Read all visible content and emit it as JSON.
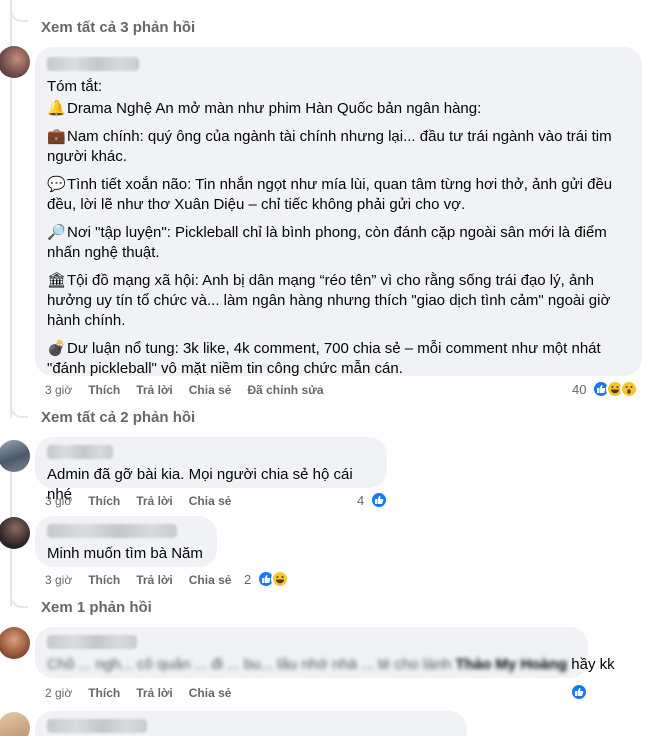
{
  "top_link": "Xem tất cả 3 phản hồi",
  "comment1": {
    "paragraphs": [
      {
        "icon": "",
        "text": "Tóm tắt:"
      },
      {
        "icon": "🔔",
        "icon_name": "bell-icon",
        "text": "Drama Nghệ An mở màn như phim Hàn Quốc bản ngân hàng:"
      },
      {
        "icon": "💼",
        "icon_name": "briefcase-icon",
        "text": "Nam chính: quý ông của ngành tài chính nhưng lại... đầu tư trái ngành vào trái tim người khác."
      },
      {
        "icon": "💬",
        "icon_name": "speech-bubble-icon",
        "text": "Tình tiết xoắn não: Tin nhắn ngọt như mía lùi, quan tâm từng hơi thở, ảnh gửi đều đều, lời lẽ như thơ Xuân Diệu – chỉ tiếc không phải gửi cho vợ."
      },
      {
        "icon": "🔎",
        "icon_name": "magnifier-icon",
        "text": "Nơi \"tập luyện\": Pickleball chỉ là bình phong, còn đánh cặp ngoài sân mới là điểm nhấn nghệ thuật."
      },
      {
        "icon": "🏛",
        "icon_name": "bank-icon",
        "text": "Tội đồ mạng xã hội: Anh bị dân mạng “réo tên” vì cho rằng sống trái đạo lý, ảnh hưởng uy tín tổ chức và... làm ngân hàng nhưng thích \"giao dịch tình cảm\" ngoài giờ hành chính."
      },
      {
        "icon": "💣",
        "icon_name": "bomb-icon",
        "text": "Dư luận nổ tung: 3k like, 4k comment, 700 chia sẻ – mỗi comment như một nhát \"đánh pickleball\" vô mặt niềm tin công chức mẫn cán."
      }
    ],
    "time": "3 giờ",
    "like": "Thích",
    "reply": "Trả lời",
    "share": "Chia sẻ",
    "edited": "Đã chỉnh sửa",
    "reaction_count": "40"
  },
  "link2": "Xem tất cả 2 phản hồi",
  "comment2": {
    "text": "Admin đã gỡ bài kia. Mọi người chia sẻ hộ cái nhé",
    "time": "3 giờ",
    "like": "Thích",
    "reply": "Trả lời",
    "share": "Chia sẻ",
    "reaction_count": "4"
  },
  "comment3": {
    "text": "Minh muốn tìm bà Năm",
    "time": "3 giờ",
    "like": "Thích",
    "reply": "Trả lời",
    "share": "Chia sẻ",
    "reaction_count": "2"
  },
  "link3": "Xem 1 phản hồi",
  "comment4": {
    "text_blurred": "Chồ ... ngh... cô quản ... đi ... bu... lâu nhớ nhà ... tè cho lành",
    "tag": "Thảo My Hoàng",
    "text_end": "hầy kk",
    "time": "2 giờ",
    "like": "Thích",
    "reply": "Trả lời",
    "share": "Chia sẻ"
  },
  "colors": {
    "bubble": "#f0f2f5",
    "meta_text": "#65676b",
    "like_blue": "#1877f2",
    "haha_yellow": "#f7c531"
  }
}
